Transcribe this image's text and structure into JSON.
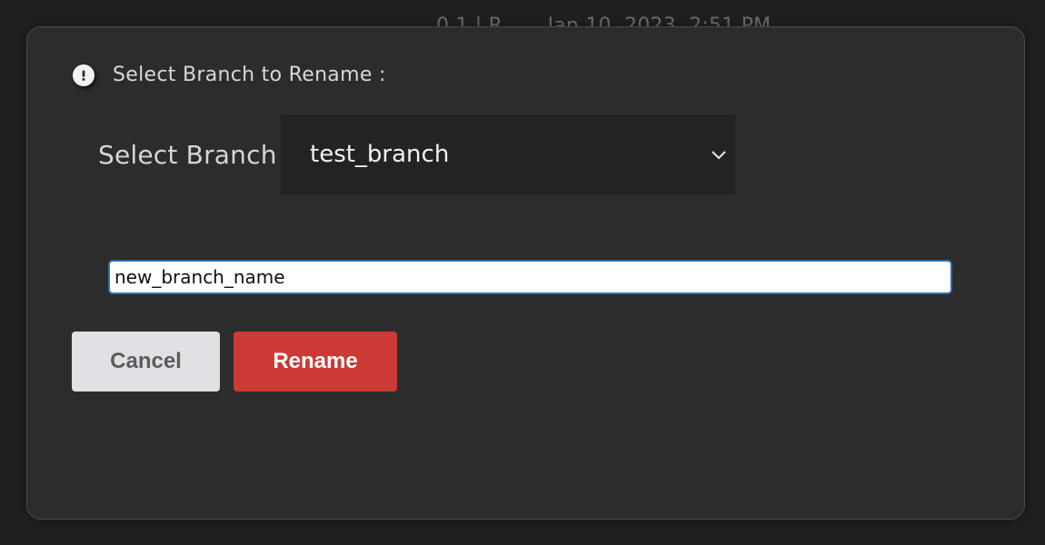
{
  "background": {
    "partial_text": "0.1 | R... ...Jan 10, 2023, 2:51 PM"
  },
  "dialog": {
    "header": {
      "icon": "exclamation-circle-icon",
      "title": "Select Branch to Rename :"
    },
    "branch_select": {
      "label": "Select Branch",
      "selected_value": "test_branch",
      "icon": "chevron-down-icon"
    },
    "new_name_input": {
      "value": "new_branch_name"
    },
    "buttons": {
      "cancel_label": "Cancel",
      "rename_label": "Rename"
    }
  },
  "colors": {
    "page_background": "#1f1f1f",
    "dialog_background": "#2c2c2c",
    "select_background": "#232323",
    "input_border": "#2f6fb0",
    "cancel_background": "#e0e1e4",
    "rename_background": "#cc3a35"
  }
}
